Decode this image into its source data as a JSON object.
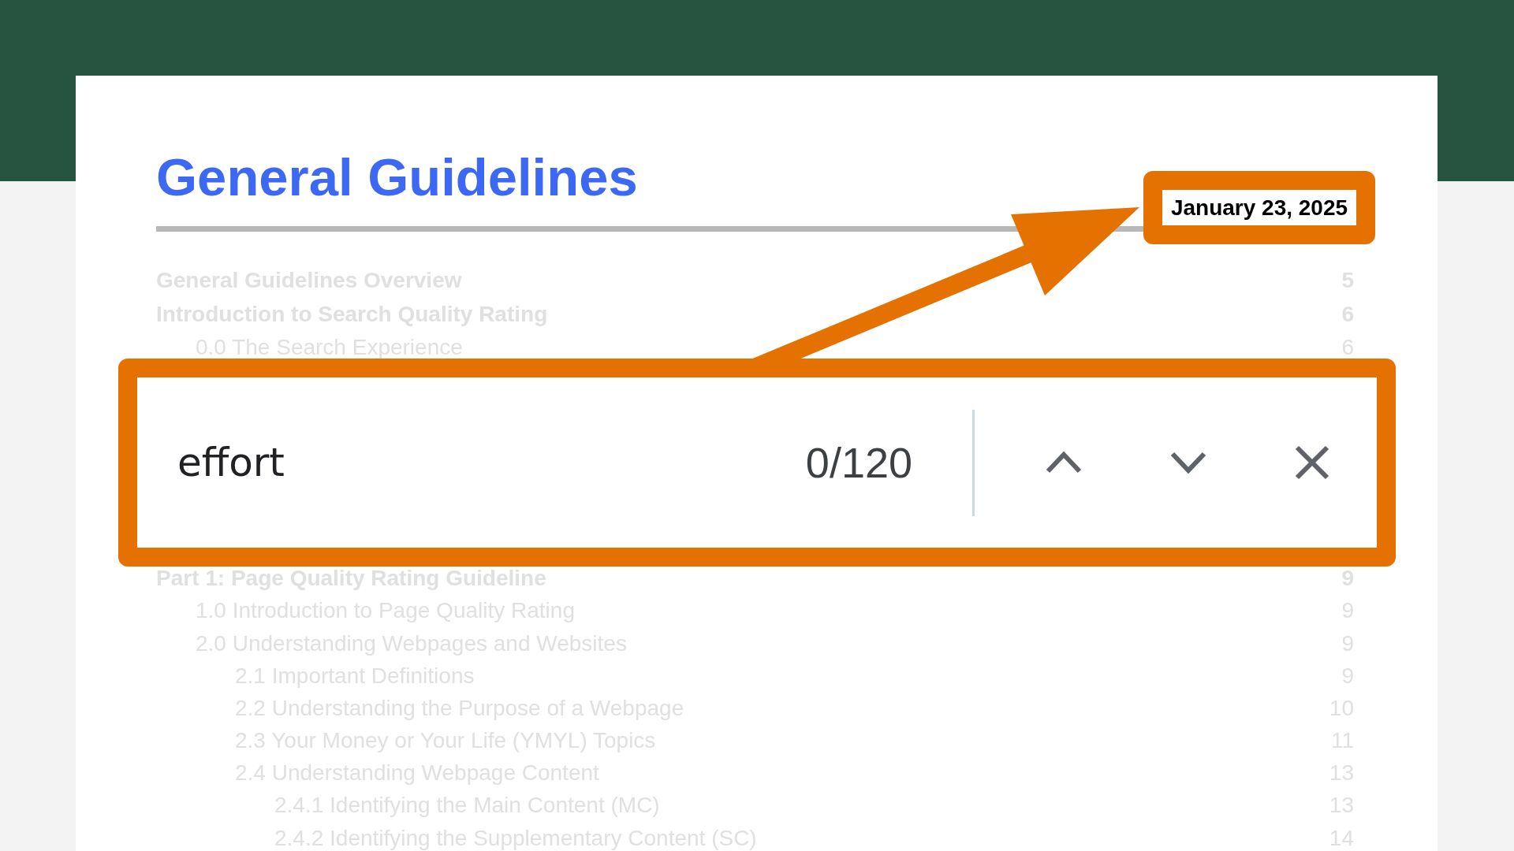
{
  "document": {
    "title": "General Guidelines",
    "date": "January 23, 2025",
    "toc": [
      {
        "label": "General Guidelines Overview",
        "page": "5"
      },
      {
        "label": "Introduction to Search Quality Rating",
        "page": "6",
        "children": [
          {
            "label": "0.0 The Search Experience",
            "page": "6"
          }
        ]
      },
      {
        "label": "Part 1: Page Quality Rating Guideline",
        "page": "9",
        "children": [
          {
            "label": "1.0 Introduction to Page Quality Rating",
            "page": "9"
          },
          {
            "label": "2.0 Understanding Webpages and Websites",
            "page": "9",
            "children": [
              {
                "label": "2.1 Important Definitions",
                "page": "9"
              },
              {
                "label": "2.2 Understanding the Purpose of a Webpage",
                "page": "10"
              },
              {
                "label": "2.3 Your Money or Your Life (YMYL) Topics",
                "page": "11"
              },
              {
                "label": "2.4 Understanding Webpage Content",
                "page": "13",
                "children": [
                  {
                    "label": "2.4.1 Identifying the Main Content (MC)",
                    "page": "13"
                  },
                  {
                    "label": "2.4.2 Identifying the Supplementary Content (SC)",
                    "page": "14"
                  }
                ]
              }
            ]
          }
        ]
      }
    ]
  },
  "find_bar": {
    "query": "effort",
    "count": "0/120"
  }
}
